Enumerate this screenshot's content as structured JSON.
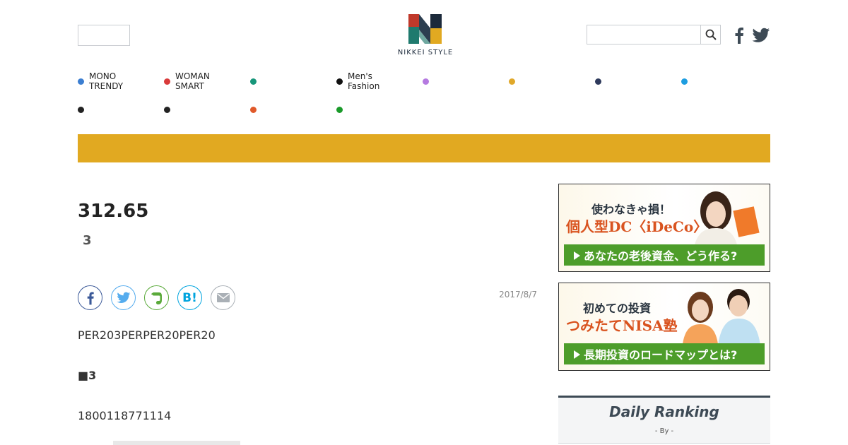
{
  "header": {
    "logo_text": "NIKKEI STYLE",
    "search": {
      "value": "",
      "placeholder": ""
    },
    "icons": [
      "search-icon",
      "facebook-icon",
      "twitter-icon"
    ]
  },
  "nav": {
    "row1": [
      {
        "label_line1": "MONO",
        "label_line2": "TRENDY",
        "color": "#3b7ed1"
      },
      {
        "label_line1": "WOMAN",
        "label_line2": "SMART",
        "color": "#d93a3a"
      },
      {
        "label_line1": "",
        "label_line2": "",
        "color": "#17967a"
      },
      {
        "label_line1": "Men's",
        "label_line2": "Fashion",
        "color": "#111111"
      },
      {
        "label_line1": "",
        "label_line2": "",
        "color": "#b57ae0"
      },
      {
        "label_line1": "",
        "label_line2": "",
        "color": "#e0a82a"
      },
      {
        "label_line1": "",
        "label_line2": "",
        "color": "#2e3a5c"
      },
      {
        "label_line1": "",
        "label_line2": "",
        "color": "#1d9de0"
      }
    ],
    "row2": [
      {
        "label_line1": "",
        "label_line2": "",
        "color": "#222222"
      },
      {
        "label_line1": "",
        "label_line2": "",
        "color": "#222222"
      },
      {
        "label_line1": "",
        "label_line2": "",
        "color": "#e0592a"
      },
      {
        "label_line1": "",
        "label_line2": "",
        "color": "#1a9a2a"
      }
    ]
  },
  "banner": {
    "color": "#e1a921"
  },
  "article": {
    "price": "312.65",
    "subnum": "3",
    "date": "2017/8/7",
    "share_icons": [
      "facebook-icon",
      "twitter-icon",
      "evernote-icon",
      "hatena-bookmark-icon",
      "mail-icon"
    ],
    "hatena_label": "B!",
    "p1": "PER203PERPER20PER20",
    "p2": "■3",
    "p3": "1800118771114"
  },
  "ads": [
    {
      "head1": "使わなきゃ損！",
      "head2": "個人型DC〈iDeCo〉",
      "button": "あなたの老後資金、どう作る?"
    },
    {
      "head1": "初めての投資",
      "head2": "つみたてNISA塾",
      "button": "長期投資のロードマップとは?"
    }
  ],
  "ranking": {
    "title": "Daily Ranking",
    "by": "- By  -"
  },
  "colors": {
    "facebook": "#3b5998",
    "twitter": "#55acee",
    "evernote": "#5aaa3a",
    "hatena": "#00a4de",
    "mail": "#aab0b6",
    "ad_button": "#4d9d2a",
    "ad_accent": "#d9531f"
  }
}
